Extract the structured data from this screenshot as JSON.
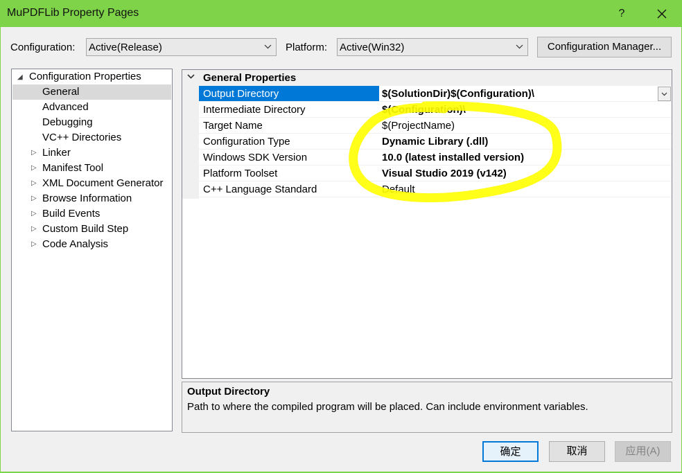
{
  "window": {
    "title": "MuPDFLib Property Pages",
    "help": "?"
  },
  "toolbar": {
    "configuration_label": "Configuration:",
    "configuration_value": "Active(Release)",
    "platform_label": "Platform:",
    "platform_value": "Active(Win32)",
    "config_manager_label": "Configuration Manager..."
  },
  "tree": {
    "root": "Configuration Properties",
    "children": [
      {
        "label": "General",
        "selected": true
      },
      {
        "label": "Advanced"
      },
      {
        "label": "Debugging"
      },
      {
        "label": "VC++ Directories"
      },
      {
        "label": "Linker",
        "expandable": true
      },
      {
        "label": "Manifest Tool",
        "expandable": true
      },
      {
        "label": "XML Document Generator",
        "expandable": true
      },
      {
        "label": "Browse Information",
        "expandable": true
      },
      {
        "label": "Build Events",
        "expandable": true
      },
      {
        "label": "Custom Build Step",
        "expandable": true
      },
      {
        "label": "Code Analysis",
        "expandable": true
      }
    ]
  },
  "grid": {
    "category": "General Properties",
    "rows": [
      {
        "name": "Output Directory",
        "value": "$(SolutionDir)$(Configuration)\\"
      },
      {
        "name": "Intermediate Directory",
        "value": "$(Configuration)\\"
      },
      {
        "name": "Target Name",
        "value": "$(ProjectName)"
      },
      {
        "name": "Configuration Type",
        "value": "Dynamic Library (.dll)"
      },
      {
        "name": "Windows SDK Version",
        "value": "10.0 (latest installed version)"
      },
      {
        "name": "Platform Toolset",
        "value": "Visual Studio 2019 (v142)"
      },
      {
        "name": "C++ Language Standard",
        "value": "Default"
      }
    ]
  },
  "description": {
    "title": "Output Directory",
    "text": "Path to where the compiled program will be placed. Can include environment variables."
  },
  "buttons": {
    "ok": "确定",
    "cancel": "取消",
    "apply": "应用(A)"
  },
  "colors": {
    "titlebar": "#7ed348",
    "selection": "#0078d7",
    "annotation": "#ffff00"
  }
}
